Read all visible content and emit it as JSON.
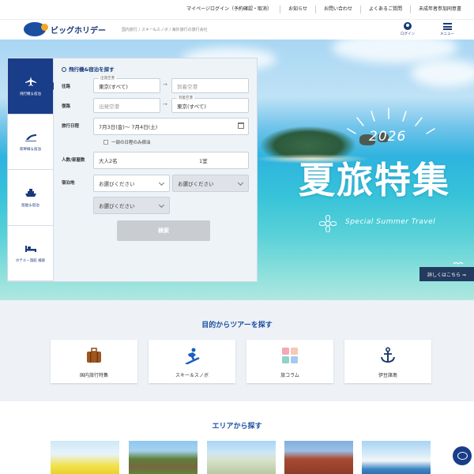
{
  "util_links": [
    "マイページログイン（予約確認・取消）",
    "お知らせ",
    "お問い合わせ",
    "よくあるご質問",
    "未成年者参加同意書"
  ],
  "brand": {
    "name": "ビッグホリデー",
    "tagline": "国内旅行 / スキー&スノボ / 海外旅行の旅行会社"
  },
  "header": {
    "login_label": "ログイン",
    "menu_label": "メニュー"
  },
  "hero": {
    "year": "2026",
    "title": "夏旅特集",
    "subtitle": "Special Summer Travel",
    "detail_label": "詳しくはこちら ⇒"
  },
  "search": {
    "tabs": [
      {
        "label": "飛行機＆宿泊",
        "icon": "airplane-icon"
      },
      {
        "label": "新幹線＆宿泊",
        "icon": "shinkansen-icon"
      },
      {
        "label": "船舶＆宿泊",
        "icon": "ship-icon"
      },
      {
        "label": "ホテル・旅館 検索",
        "icon": "bed-icon"
      }
    ],
    "title": "飛行機&宿泊を探す",
    "outbound_label": "往路",
    "return_label": "復路",
    "depart_airport_caption": "出発空港",
    "arrive_airport_caption": "到着空港",
    "outbound_from": "東京(すべて)",
    "outbound_to_placeholder": "到着空港",
    "return_from_placeholder": "出発空港",
    "return_to": "東京(すべて)",
    "dates_label": "旅行日程",
    "dates_value": "7月3日(金)～ 7月4日(土)",
    "partial_stay_label": "一部の日程のみ宿泊",
    "guests_label": "人数/部屋数",
    "guests_value": "大人2名",
    "rooms_value": "1室",
    "destination_label": "宿泊地",
    "select_placeholder": "お選びください",
    "search_button": "検索"
  },
  "purpose": {
    "title": "目的からツアーを探す",
    "items": [
      {
        "label": "国内旅行特集",
        "icon": "suitcase-icon"
      },
      {
        "label": "スキー＆スノボ",
        "icon": "snowboarder-icon"
      },
      {
        "label": "旅コラム",
        "icon": "column-tiles-icon"
      },
      {
        "label": "伊豆諸島",
        "icon": "anchor-icon"
      }
    ]
  },
  "area": {
    "title": "エリアから探す"
  },
  "colors": {
    "brand_navy": "#1a3d8a",
    "accent_blue": "#1a4fa0",
    "button_disabled": "#c9cdd2"
  }
}
